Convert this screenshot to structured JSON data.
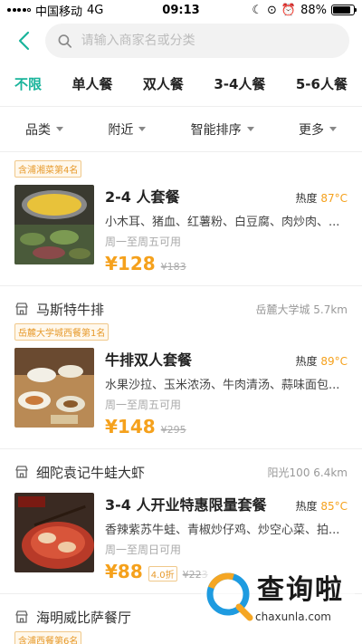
{
  "status_bar": {
    "carrier": "中国移动",
    "network": "4G",
    "time": "09:13",
    "battery": "88%",
    "battery_level": 0.88
  },
  "search": {
    "placeholder": "请输入商家名或分类"
  },
  "tabs": [
    {
      "label": "不限",
      "active": true
    },
    {
      "label": "单人餐",
      "active": false
    },
    {
      "label": "双人餐",
      "active": false
    },
    {
      "label": "3-4人餐",
      "active": false
    },
    {
      "label": "5-6人餐",
      "active": false
    }
  ],
  "filters": [
    {
      "label": "品类"
    },
    {
      "label": "附近"
    },
    {
      "label": "智能排序"
    },
    {
      "label": "更多"
    }
  ],
  "shops": [
    {
      "rank_badge": "含浦湘菜第4名",
      "deal": {
        "title": "2-4 人套餐",
        "heat_label": "热度",
        "heat": "87°C",
        "items": "小木耳、猪血、红薯粉、白豆腐、肉炒肉、...",
        "availability": "周一至周五可用",
        "price": "¥128",
        "original_price": "¥183"
      }
    },
    {
      "name": "马斯特牛排",
      "location": "岳麓大学城 5.7km",
      "rank_badge": "岳麓大学城西餐第1名",
      "deal": {
        "title": "牛排双人套餐",
        "heat_label": "热度",
        "heat": "89°C",
        "items": "水果沙拉、玉米浓汤、牛肉清汤、蒜味面包...",
        "availability": "周一至周五可用",
        "price": "¥148",
        "original_price": "¥295"
      }
    },
    {
      "name": "细陀袁记牛蛙大虾",
      "location": "阳光100 6.4km",
      "deal": {
        "title": "3-4 人开业特惠限量套餐",
        "heat_label": "热度",
        "heat": "85°C",
        "items": "香辣紫苏牛蛙、青椒炒仔鸡、炒空心菜、拍...",
        "availability": "周一至周日可用",
        "price": "¥88",
        "discount": "4.0折",
        "original_price": "¥223"
      }
    },
    {
      "name": "海明威比萨餐厅",
      "rank_badge": "含浦西餐第6名"
    }
  ],
  "watermark": {
    "text": "查询啦",
    "url": "chaxunla.com"
  },
  "colors": {
    "accent": "#19b49b",
    "price": "#f5a11c"
  }
}
